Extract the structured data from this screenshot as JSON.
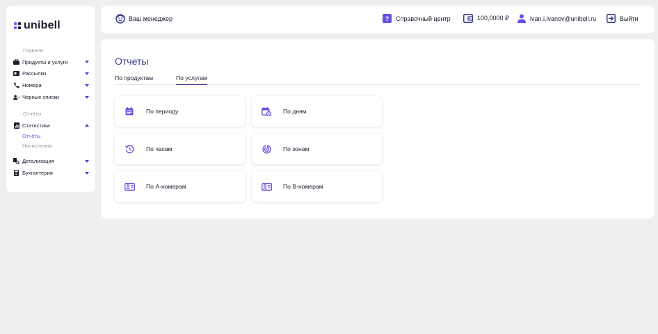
{
  "brand": {
    "name": "unibell",
    "accent": "#7a55f0",
    "dark": "#1c1c2e"
  },
  "sidebar": {
    "items": [
      {
        "label": "Главное",
        "icon": "none",
        "muted": true
      },
      {
        "label": "Продукты и услуги",
        "icon": "briefcase-icon",
        "expandable": true
      },
      {
        "label": "Рассылки",
        "icon": "mail-icon",
        "expandable": true
      },
      {
        "label": "Номера",
        "icon": "phone-icon",
        "expandable": true
      },
      {
        "label": "Черные списки",
        "icon": "user-block-icon",
        "expandable": true
      },
      {
        "label": "Отчёты",
        "icon": "none",
        "muted": true
      },
      {
        "label": "Статистика",
        "icon": "stats-icon",
        "expanded": true
      },
      {
        "label": "Отчёты",
        "sub": true,
        "active": true
      },
      {
        "label": "Начисления",
        "sub": true
      },
      {
        "label": "Детализация",
        "icon": "detail-icon",
        "expandable": true
      },
      {
        "label": "Бухгалтерия",
        "icon": "accounting-icon",
        "expandable": true
      }
    ]
  },
  "topbar": {
    "manager": "Ваш менеджер",
    "help": "Справочный центр",
    "balance": "100,0000 ₽",
    "email": "ivan.i.ivanov@unibell.ru",
    "logout": "Выйти"
  },
  "main": {
    "title": "Отчеты",
    "tabs": [
      {
        "label": "По продуктам",
        "active": false
      },
      {
        "label": "По услугам",
        "active": true
      }
    ],
    "cards": [
      {
        "label": "По периоду",
        "icon": "calendar-icon"
      },
      {
        "label": "По дням",
        "icon": "calendar-clock-icon"
      },
      {
        "label": "По часам",
        "icon": "history-icon"
      },
      {
        "label": "По зонам",
        "icon": "target-icon"
      },
      {
        "label": "По А-номерам",
        "icon": "contact-card-icon"
      },
      {
        "label": "По В-номерам",
        "icon": "contact-card-icon"
      }
    ]
  }
}
